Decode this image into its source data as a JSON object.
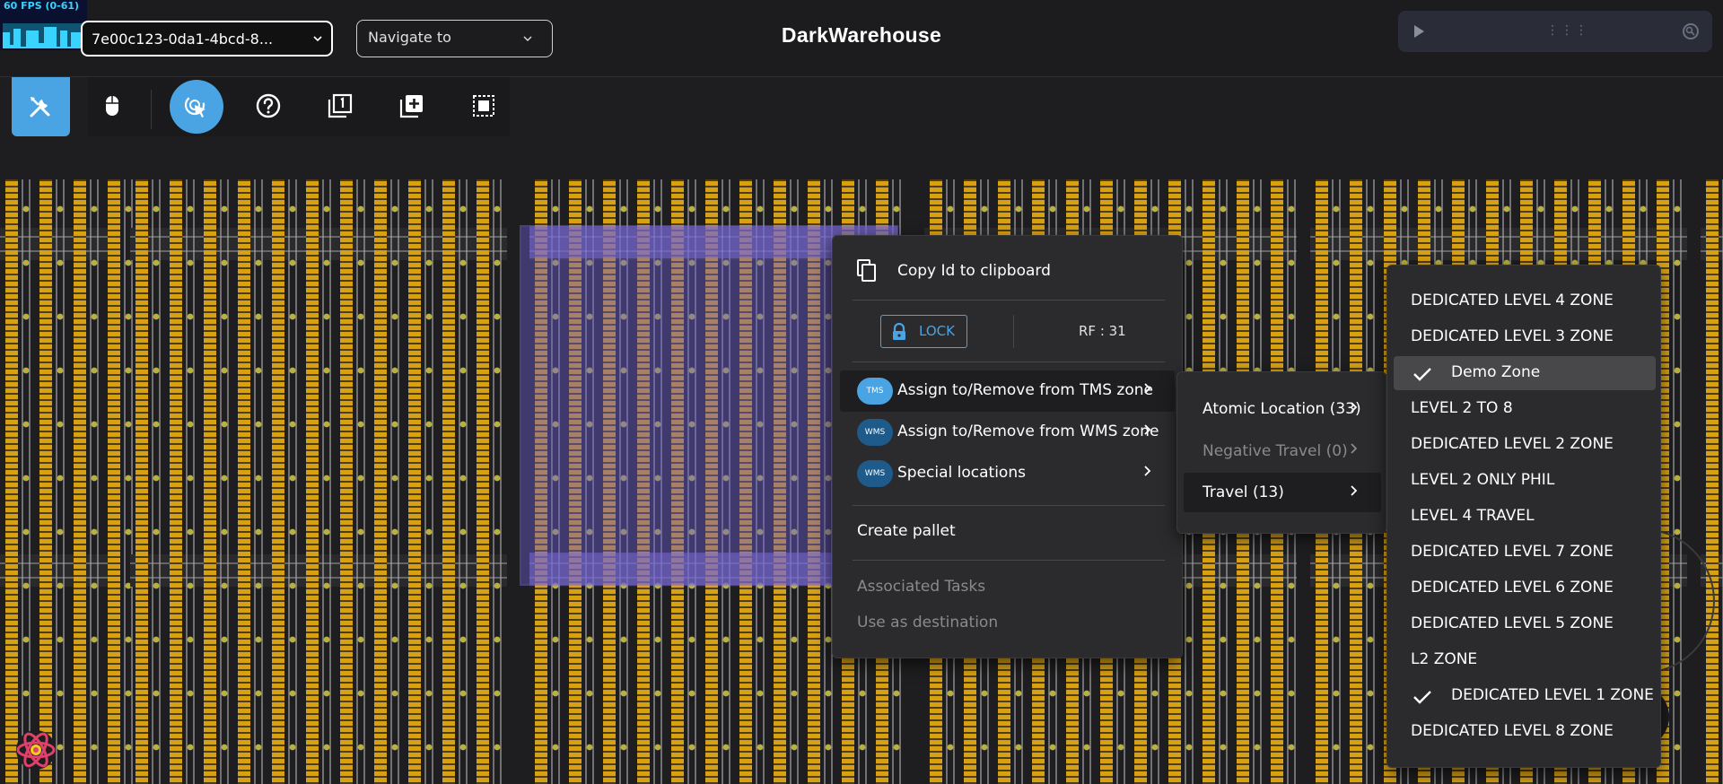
{
  "fps": {
    "label": "60 FPS (0-61)"
  },
  "header": {
    "session_value": "7e00c123-0da1-4bcd-8...",
    "navigate_placeholder": "Navigate to",
    "title": "DarkWarehouse"
  },
  "toolbar": {
    "tools": [
      "tools-icon",
      "mouse-icon",
      "cursor-select-icon",
      "help-icon",
      "layer-one-icon",
      "add-box-icon",
      "select-area-icon"
    ],
    "active_tool": "tools-icon"
  },
  "context_menu": {
    "copy_id": "Copy Id to clipboard",
    "lock": "LOCK",
    "rf": "RF : 31",
    "tms": {
      "badge": "TMS",
      "label": "Assign to/Remove from TMS zone"
    },
    "wms": {
      "badge": "WMS",
      "label": "Assign to/Remove from WMS zone"
    },
    "special": {
      "badge": "WMS",
      "label": "Special locations"
    },
    "create_pallet": "Create pallet",
    "associated_tasks": "Associated Tasks",
    "use_as_destination": "Use as destination"
  },
  "sub_menu": {
    "items": [
      {
        "label": "Atomic Location (33)",
        "disabled": false
      },
      {
        "label": "Negative Travel (0)",
        "disabled": true
      },
      {
        "label": "Travel (13)",
        "disabled": false,
        "highlighted": true
      }
    ]
  },
  "zone_menu": {
    "items": [
      {
        "label": "DEDICATED LEVEL 4 ZONE",
        "checked": false
      },
      {
        "label": "DEDICATED LEVEL 3 ZONE",
        "checked": false
      },
      {
        "label": "Demo Zone",
        "checked": true,
        "highlighted": true
      },
      {
        "label": "LEVEL 2 TO 8",
        "checked": false
      },
      {
        "label": "DEDICATED LEVEL 2 ZONE",
        "checked": false
      },
      {
        "label": "LEVEL 2 ONLY PHIL",
        "checked": false
      },
      {
        "label": "LEVEL 4 TRAVEL",
        "checked": false
      },
      {
        "label": "DEDICATED LEVEL 7 ZONE",
        "checked": false
      },
      {
        "label": "DEDICATED LEVEL 6 ZONE",
        "checked": false
      },
      {
        "label": "DEDICATED LEVEL 5 ZONE",
        "checked": false
      },
      {
        "label": "L2 ZONE",
        "checked": false
      },
      {
        "label": "DEDICATED LEVEL 1 ZONE",
        "checked": true
      },
      {
        "label": "DEDICATED LEVEL 8 ZONE",
        "checked": false
      }
    ]
  },
  "colors": {
    "accent": "#4aa3e2",
    "rack": "#d8a013",
    "selection": "#6a5acd",
    "background": "#1e1e20"
  }
}
